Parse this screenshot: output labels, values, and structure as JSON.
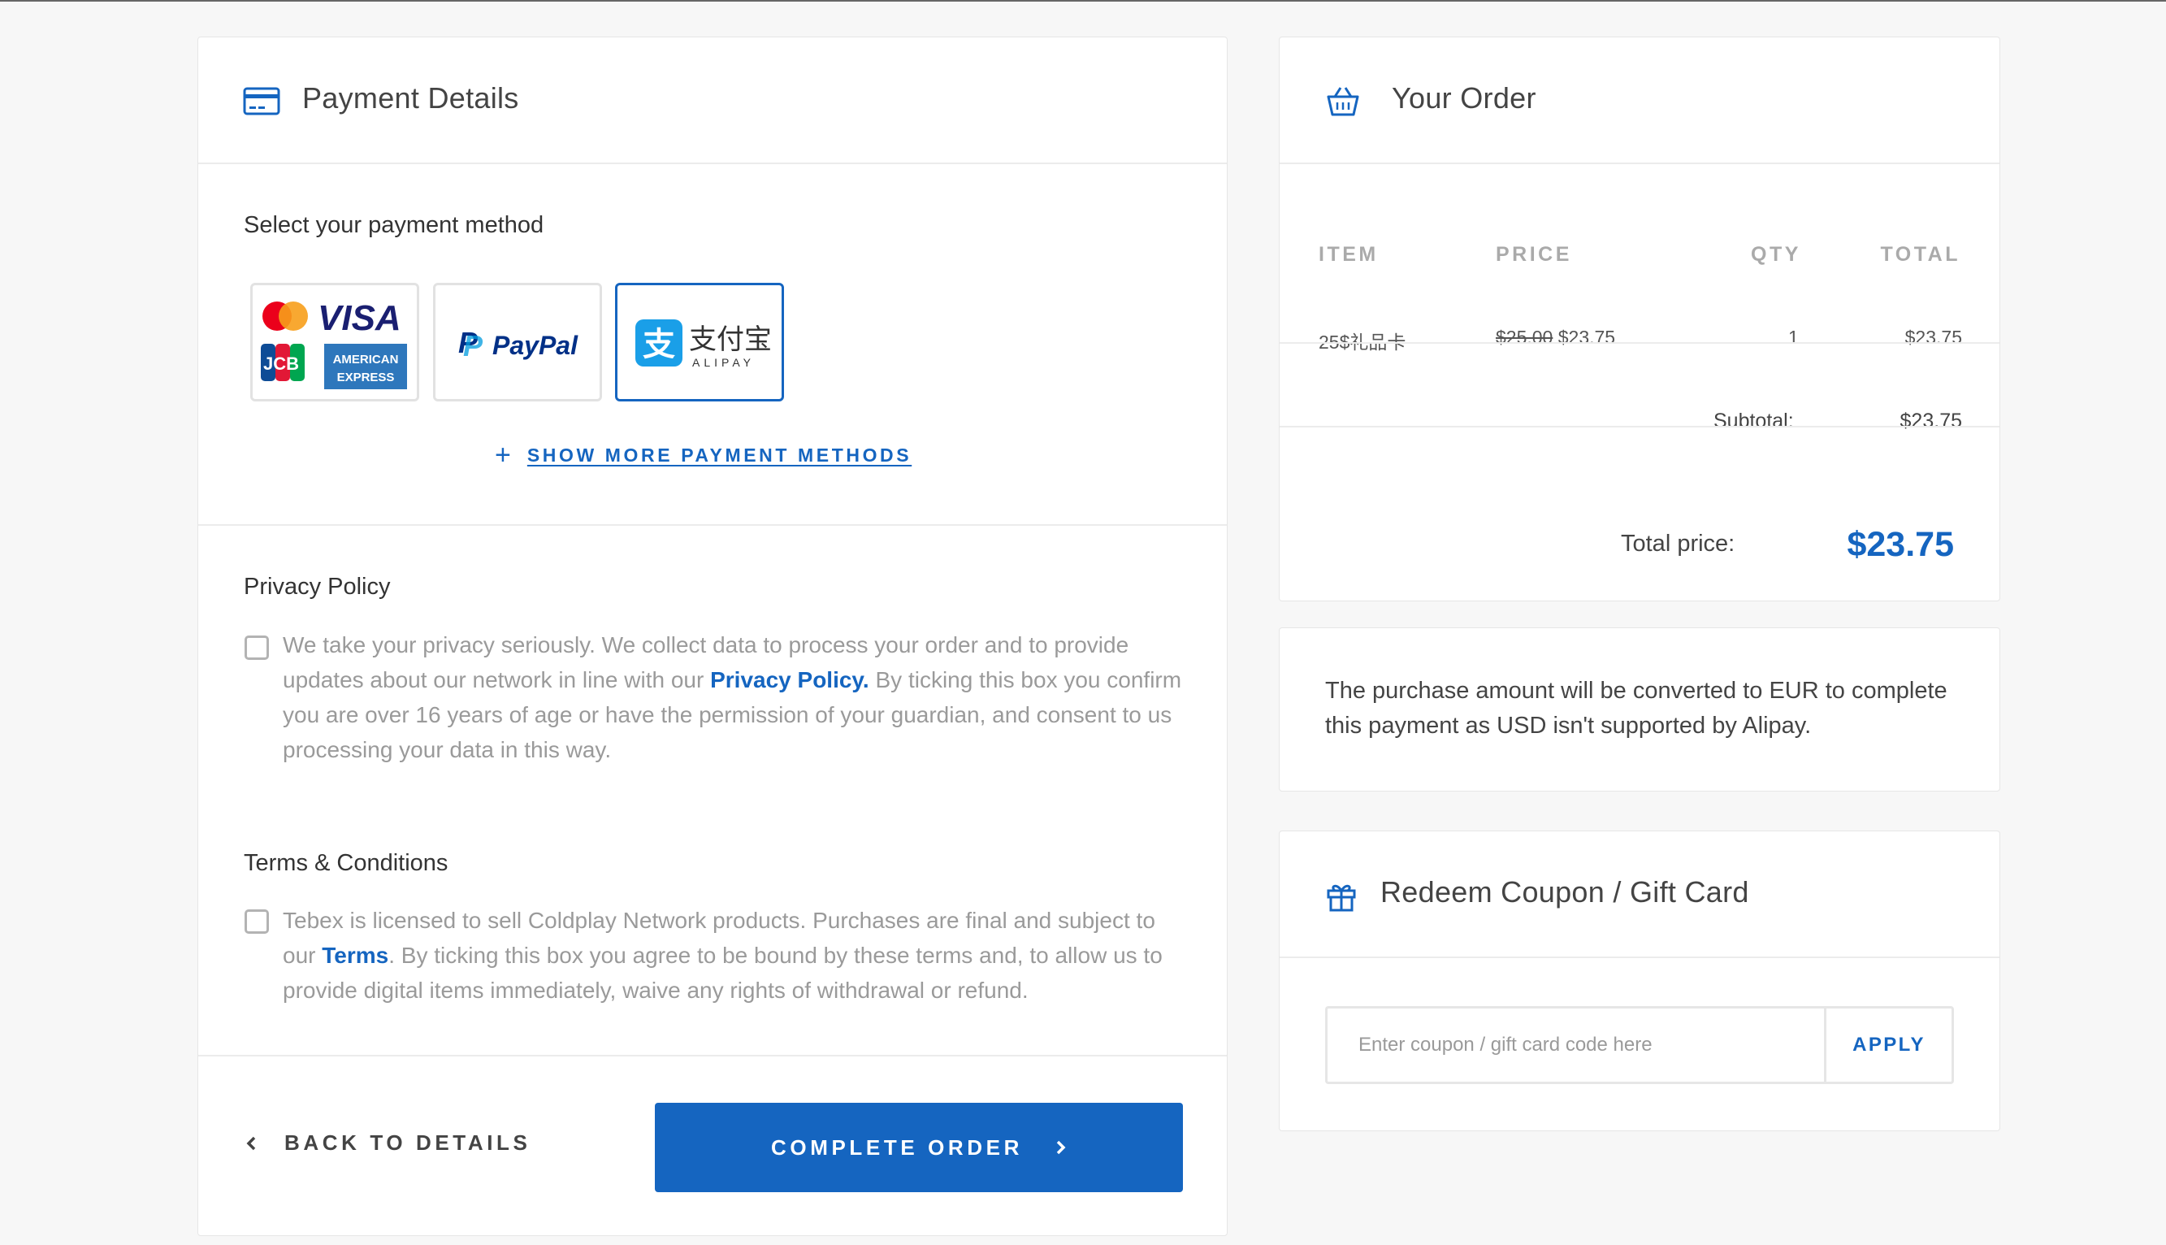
{
  "payment": {
    "title": "Payment Details",
    "select_label": "Select your payment method",
    "methods": [
      {
        "name": "Cards",
        "brands": [
          "VISA",
          "JCB",
          "AMERICAN",
          "EXPRESS"
        ],
        "selected": false
      },
      {
        "name": "PayPal",
        "selected": false
      },
      {
        "name": "Alipay",
        "cn": "支付宝",
        "en": "ALIPAY",
        "selected": true
      }
    ],
    "show_more": "SHOW MORE PAYMENT METHODS",
    "privacy": {
      "heading": "Privacy Policy",
      "text_before": "We take your privacy seriously. We collect data to process your order and to provide updates about our network in line with our ",
      "link": "Privacy Policy.",
      "text_after": " By ticking this box you confirm you are over 16 years of age or have the permission of your guardian, and consent to us processing your data in this way."
    },
    "terms": {
      "heading": "Terms & Conditions",
      "text_before": "Tebex is licensed to sell Coldplay Network products. Purchases are final and subject to our ",
      "link": "Terms",
      "text_after": ". By ticking this box you agree to be bound by these terms and, to allow us to provide digital items immediately, waive any rights of withdrawal or refund."
    },
    "back_label": "BACK TO DETAILS",
    "complete_label": "COMPLETE ORDER"
  },
  "order": {
    "title": "Your Order",
    "columns": [
      "ITEM",
      "PRICE",
      "QTY",
      "TOTAL"
    ],
    "items": [
      {
        "item": "25$礼品卡",
        "old_price": "$25.00",
        "price": "$23.75",
        "qty": "1",
        "total": "$23.75"
      }
    ],
    "subtotal_label": "Subtotal:",
    "subtotal": "$23.75",
    "total_label": "Total price:",
    "total": "$23.75"
  },
  "notice": {
    "text": "The purchase amount will be converted to EUR to complete this payment as USD isn't supported by Alipay."
  },
  "coupon": {
    "title": "Redeem Coupon / Gift Card",
    "placeholder": "Enter coupon / gift card code here",
    "value": "",
    "apply_label": "APPLY"
  },
  "colors": {
    "accent": "#1565c0",
    "muted_text": "#9a9a9a",
    "border": "#e6e6e6"
  },
  "icons": [
    "credit-card-icon",
    "basket-icon",
    "gift-icon",
    "plus-icon",
    "chevron-left-icon",
    "chevron-right-icon"
  ]
}
